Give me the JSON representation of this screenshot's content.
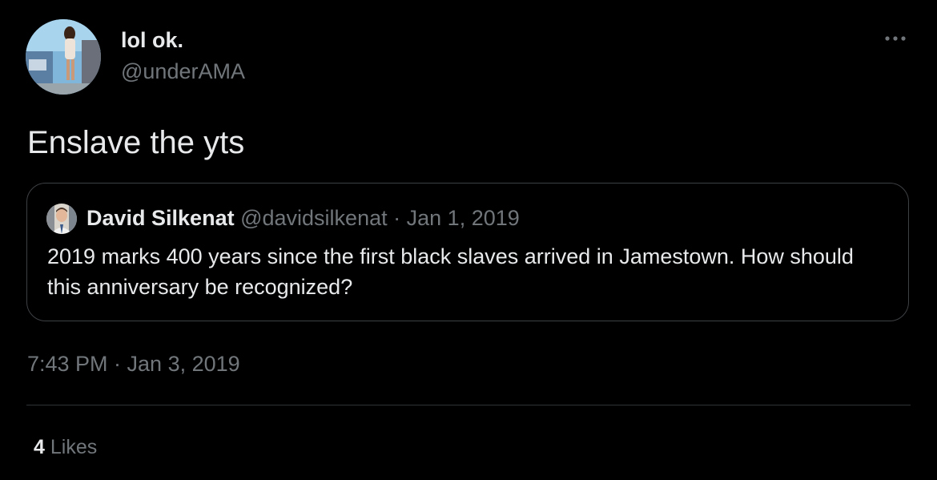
{
  "tweet": {
    "author": {
      "display_name": "lol ok.",
      "handle": "@underAMA",
      "avatar_icon": "profile-photo"
    },
    "more_icon": "more-horizontal-icon",
    "text": "Enslave the yts",
    "quoted": {
      "author_name": "David Silkenat",
      "author_handle": "@davidsilkenat",
      "separator": "·",
      "date": "Jan 1, 2019",
      "text": "2019 marks 400 years since the first black slaves arrived in Jamestown. How should this anniversary be recognized?",
      "avatar_icon": "profile-photo"
    },
    "timestamp": "7:43 PM · Jan 3, 2019",
    "likes": {
      "count": "4",
      "label": "Likes"
    }
  },
  "colors": {
    "background": "#000000",
    "primary_text": "#e7e9ea",
    "secondary_text": "#71767b",
    "border": "#3e4144"
  }
}
